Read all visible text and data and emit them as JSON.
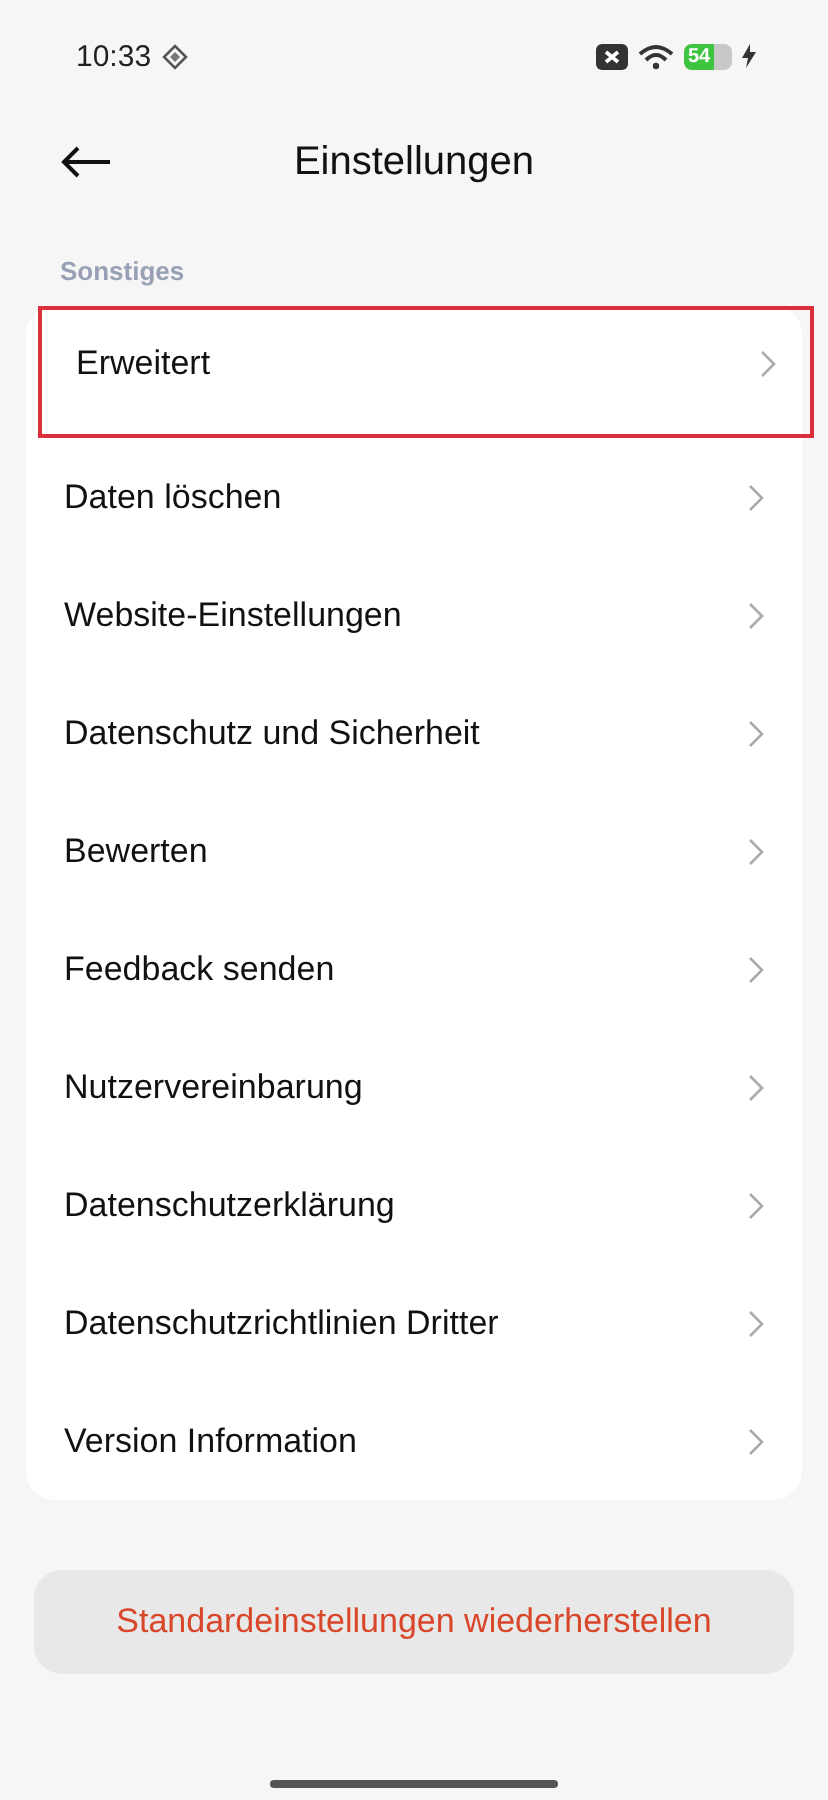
{
  "status_bar": {
    "time": "10:33",
    "battery": "54",
    "charging": true
  },
  "header": {
    "title": "Einstellungen"
  },
  "section": {
    "title": "Sonstiges"
  },
  "items": [
    {
      "label": "Erweitert",
      "highlighted": true
    },
    {
      "label": "Daten löschen",
      "highlighted": false
    },
    {
      "label": "Website-Einstellungen",
      "highlighted": false
    },
    {
      "label": "Datenschutz und Sicherheit",
      "highlighted": false
    },
    {
      "label": "Bewerten",
      "highlighted": false
    },
    {
      "label": "Feedback senden",
      "highlighted": false
    },
    {
      "label": "Nutzervereinbarung",
      "highlighted": false
    },
    {
      "label": "Datenschutzerklärung",
      "highlighted": false
    },
    {
      "label": "Datenschutzrichtlinien Dritter",
      "highlighted": false
    },
    {
      "label": "Version Information",
      "highlighted": false
    }
  ],
  "reset_button": {
    "label": "Standardeinstellungen wiederherstellen"
  }
}
